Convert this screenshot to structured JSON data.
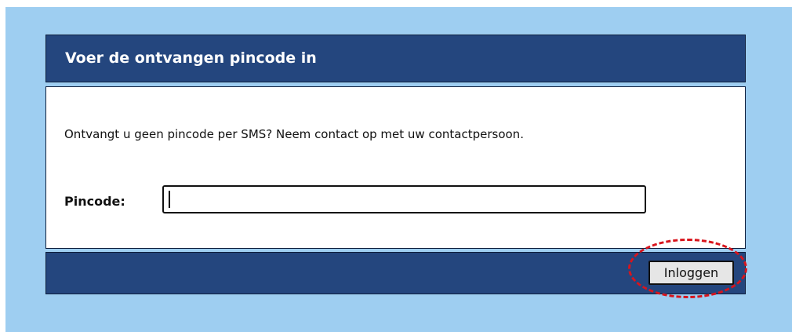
{
  "dialog": {
    "title": "Voer de ontvangen pincode in",
    "message": "Ontvangt u geen pincode per SMS? Neem contact op met uw contactpersoon.",
    "pin_label": "Pincode:",
    "pin_value": "",
    "pin_placeholder": "",
    "login_label": "Inloggen"
  },
  "colors": {
    "page_background": "#9ecef1",
    "header_background": "#24467e",
    "annotation_circle": "#d8141c"
  }
}
